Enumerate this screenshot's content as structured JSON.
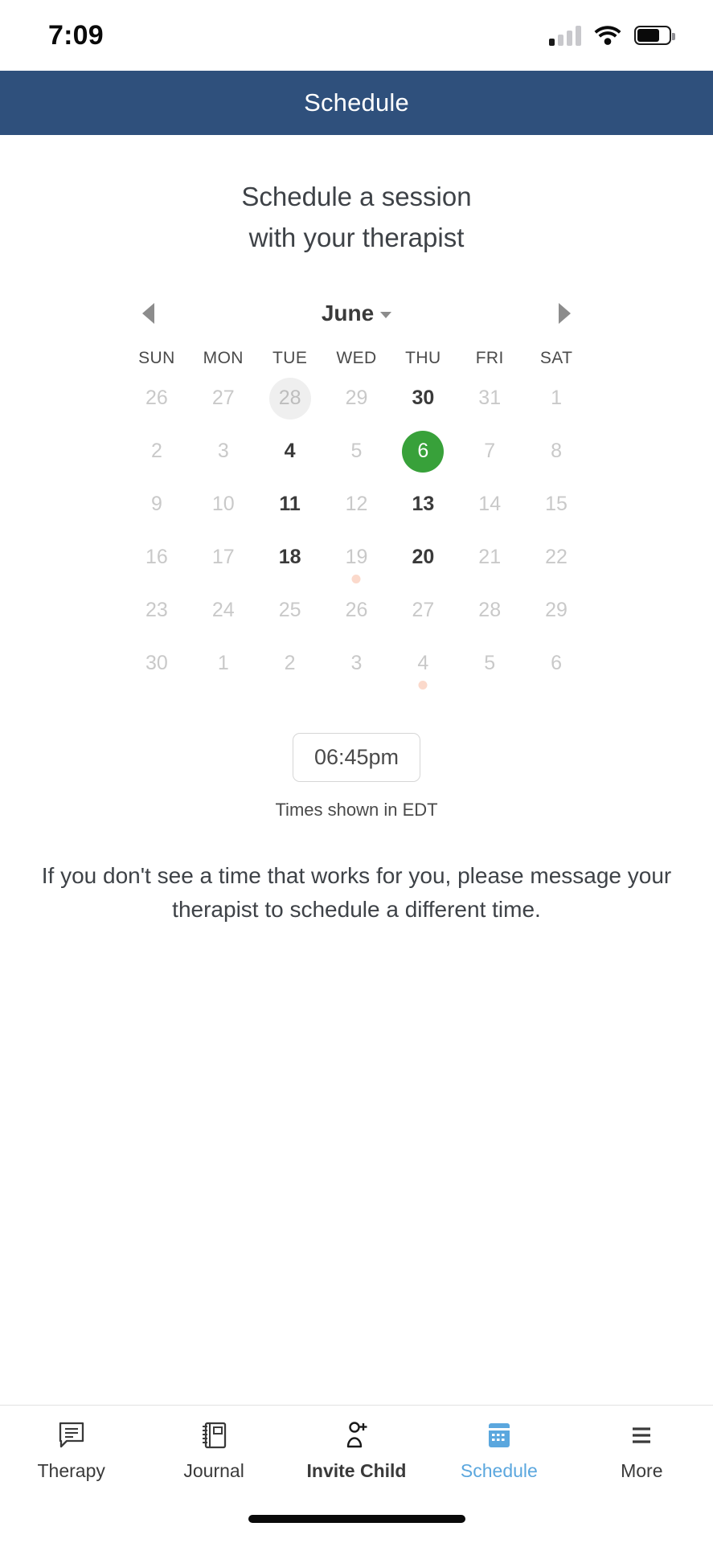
{
  "statusbar": {
    "time": "7:09",
    "signal_icon": "cellular-signal-icon",
    "wifi_icon": "wifi-icon",
    "battery_icon": "battery-icon"
  },
  "header": {
    "title": "Schedule",
    "background_color": "#2f507c"
  },
  "main": {
    "heading_line1": "Schedule a session",
    "heading_line2": "with your therapist",
    "helper_text": "If you don't see a time that works for you, please message your therapist to schedule a different time."
  },
  "calendar": {
    "month": "June",
    "prev_icon": "chevron-left-icon",
    "next_icon": "chevron-right-icon",
    "month_dropdown_icon": "caret-down-icon",
    "weekdays": [
      "SUN",
      "MON",
      "TUE",
      "WED",
      "THU",
      "FRI",
      "SAT"
    ],
    "selected_color": "#38a13a",
    "today_color": "#efefef",
    "dot_color": "#fbd9cb",
    "weeks": [
      [
        {
          "day": "26",
          "state": "disabled",
          "dot": false
        },
        {
          "day": "27",
          "state": "disabled",
          "dot": false
        },
        {
          "day": "28",
          "state": "today",
          "dot": false
        },
        {
          "day": "29",
          "state": "disabled",
          "dot": false
        },
        {
          "day": "30",
          "state": "available",
          "dot": false
        },
        {
          "day": "31",
          "state": "disabled",
          "dot": false
        },
        {
          "day": "1",
          "state": "disabled",
          "dot": false
        }
      ],
      [
        {
          "day": "2",
          "state": "disabled",
          "dot": false
        },
        {
          "day": "3",
          "state": "disabled",
          "dot": false
        },
        {
          "day": "4",
          "state": "available",
          "dot": false
        },
        {
          "day": "5",
          "state": "disabled",
          "dot": false
        },
        {
          "day": "6",
          "state": "selected",
          "dot": false
        },
        {
          "day": "7",
          "state": "disabled",
          "dot": false
        },
        {
          "day": "8",
          "state": "disabled",
          "dot": false
        }
      ],
      [
        {
          "day": "9",
          "state": "disabled",
          "dot": false
        },
        {
          "day": "10",
          "state": "disabled",
          "dot": false
        },
        {
          "day": "11",
          "state": "available",
          "dot": false
        },
        {
          "day": "12",
          "state": "disabled",
          "dot": false
        },
        {
          "day": "13",
          "state": "available",
          "dot": false
        },
        {
          "day": "14",
          "state": "disabled",
          "dot": false
        },
        {
          "day": "15",
          "state": "disabled",
          "dot": false
        }
      ],
      [
        {
          "day": "16",
          "state": "disabled",
          "dot": false
        },
        {
          "day": "17",
          "state": "disabled",
          "dot": false
        },
        {
          "day": "18",
          "state": "available",
          "dot": false
        },
        {
          "day": "19",
          "state": "disabled",
          "dot": true
        },
        {
          "day": "20",
          "state": "available",
          "dot": false
        },
        {
          "day": "21",
          "state": "disabled",
          "dot": false
        },
        {
          "day": "22",
          "state": "disabled",
          "dot": false
        }
      ],
      [
        {
          "day": "23",
          "state": "disabled",
          "dot": false
        },
        {
          "day": "24",
          "state": "disabled",
          "dot": false
        },
        {
          "day": "25",
          "state": "disabled",
          "dot": false
        },
        {
          "day": "26",
          "state": "disabled",
          "dot": false
        },
        {
          "day": "27",
          "state": "disabled",
          "dot": false
        },
        {
          "day": "28",
          "state": "disabled",
          "dot": false
        },
        {
          "day": "29",
          "state": "disabled",
          "dot": false
        }
      ],
      [
        {
          "day": "30",
          "state": "disabled",
          "dot": false
        },
        {
          "day": "1",
          "state": "disabled",
          "dot": false
        },
        {
          "day": "2",
          "state": "disabled",
          "dot": false
        },
        {
          "day": "3",
          "state": "disabled",
          "dot": false
        },
        {
          "day": "4",
          "state": "disabled",
          "dot": true
        },
        {
          "day": "5",
          "state": "disabled",
          "dot": false
        },
        {
          "day": "6",
          "state": "disabled",
          "dot": false
        }
      ]
    ]
  },
  "timeslots": {
    "slots": [
      "06:45pm"
    ],
    "timezone_note": "Times shown in EDT"
  },
  "tabbar": {
    "active_color": "#5ba7de",
    "items": [
      {
        "label": "Therapy",
        "icon": "chat-bubble-icon",
        "active": false,
        "bold": false
      },
      {
        "label": "Journal",
        "icon": "notebook-icon",
        "active": false,
        "bold": false
      },
      {
        "label": "Invite Child",
        "icon": "add-person-icon",
        "active": false,
        "bold": true
      },
      {
        "label": "Schedule",
        "icon": "calendar-icon",
        "active": true,
        "bold": false
      },
      {
        "label": "More",
        "icon": "hamburger-menu-icon",
        "active": false,
        "bold": false
      }
    ]
  }
}
